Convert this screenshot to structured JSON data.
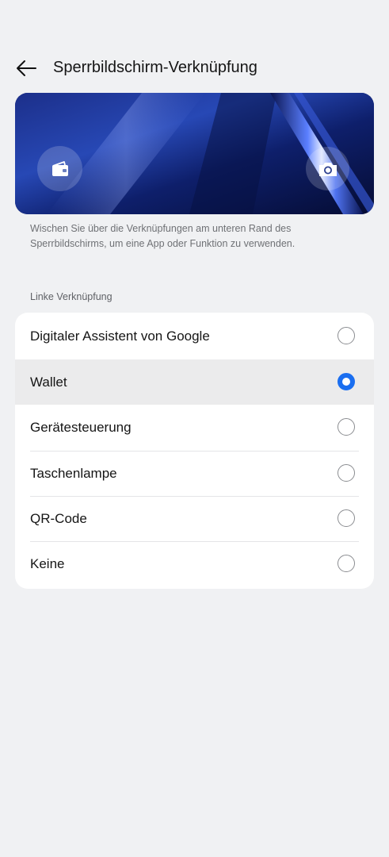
{
  "header": {
    "title": "Sperrbildschirm-Verknüpfung",
    "back_icon": "arrow-left-icon"
  },
  "preview": {
    "left_icon": "wallet-icon",
    "right_icon": "camera-icon",
    "background_colors": [
      "#0b1a55",
      "#2a55c9",
      "#1a3a9e"
    ]
  },
  "description": "Wischen Sie über die Verknüpfungen am unteren Rand des Sperrbildschirms, um eine App oder Funktion zu verwenden.",
  "section": {
    "label": "Linke Verknüpfung"
  },
  "options": [
    {
      "label": "Digitaler Assistent von Google",
      "selected": false
    },
    {
      "label": "Wallet",
      "selected": true
    },
    {
      "label": "Gerätesteuerung",
      "selected": false
    },
    {
      "label": "Taschenlampe",
      "selected": false
    },
    {
      "label": "QR-Code",
      "selected": false
    },
    {
      "label": "Keine",
      "selected": false
    }
  ],
  "colors": {
    "accent": "#1a6ef0",
    "background": "#f0f1f3",
    "card": "#ffffff",
    "selected_row": "#ebebec"
  }
}
